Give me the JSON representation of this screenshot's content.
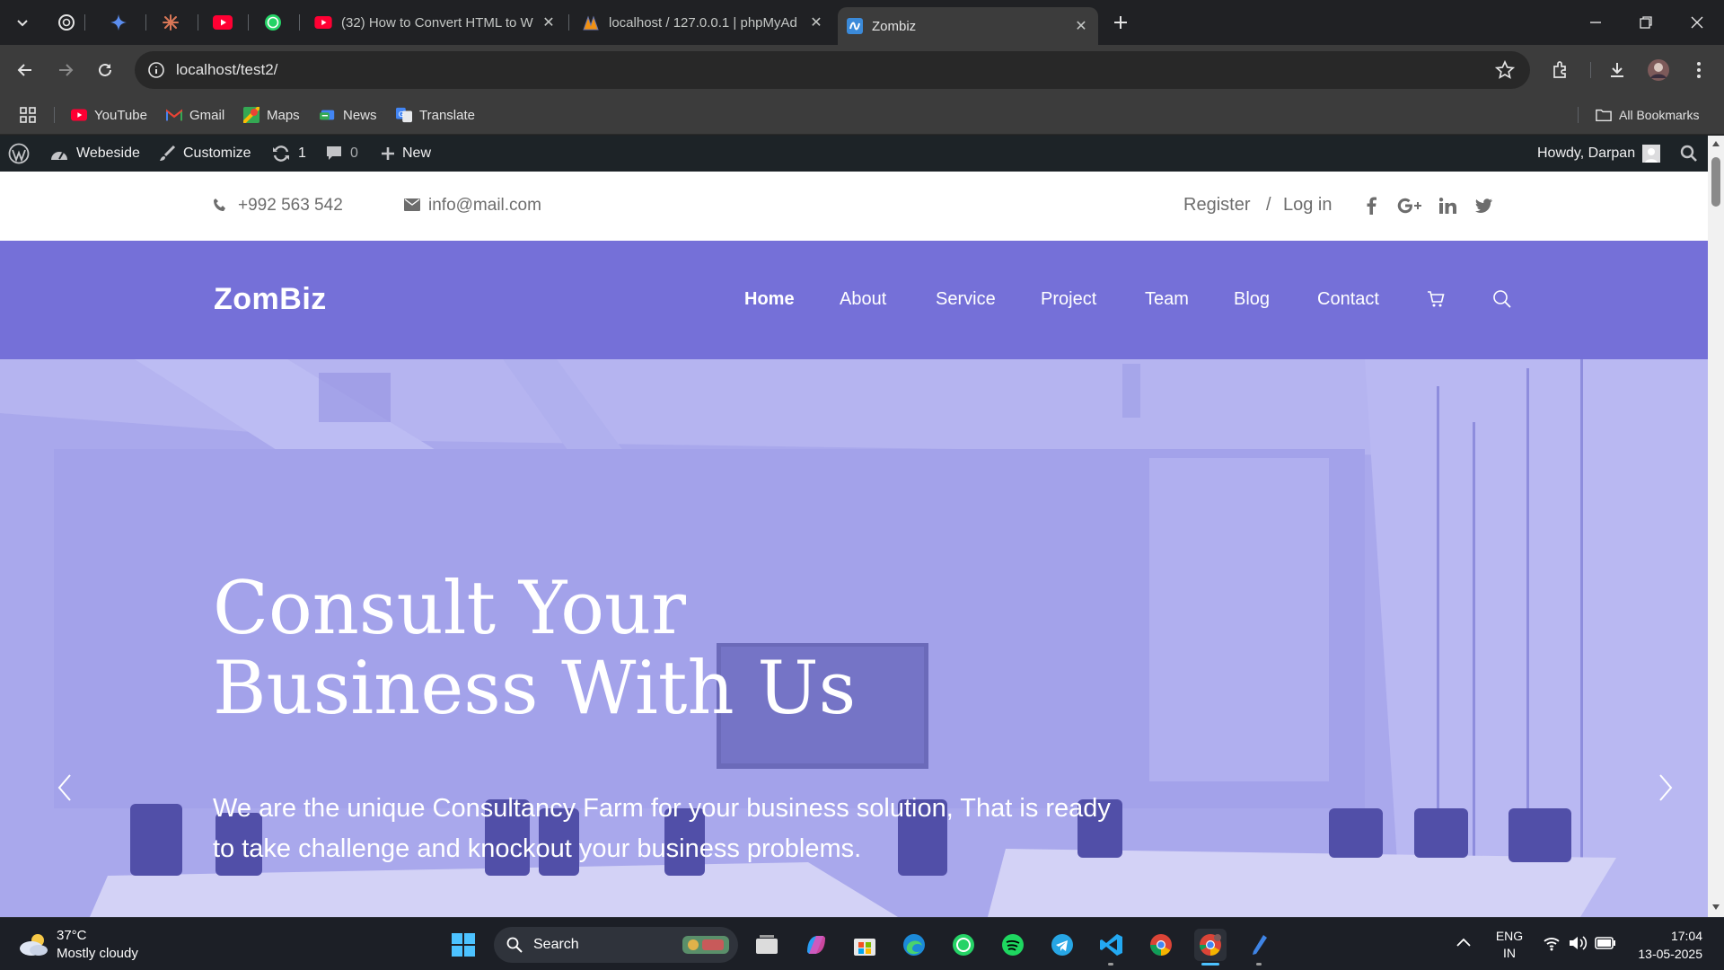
{
  "browser": {
    "tabs": [
      {
        "title": "(32) How to Convert HTML to W",
        "icon": "youtube-icon"
      },
      {
        "title": "localhost / 127.0.0.1 | phpMyAd",
        "icon": "phpmyadmin-icon"
      },
      {
        "title": "Zombiz",
        "icon": "site-favicon",
        "active": true
      }
    ],
    "url": "localhost/test2/",
    "bookmarks": [
      "YouTube",
      "Gmail",
      "Maps",
      "News",
      "Translate"
    ],
    "all_bookmarks": "All Bookmarks"
  },
  "adminbar": {
    "site_name": "Webeside",
    "customize": "Customize",
    "updates": "1",
    "comments": "0",
    "new": "New",
    "howdy": "Howdy, Darpan"
  },
  "topinfo": {
    "phone": "+992 563 542",
    "email": "info@mail.com",
    "register": "Register",
    "divider": "/",
    "login": "Log in"
  },
  "nav": {
    "logo": "ZomBiz",
    "items": [
      "Home",
      "About",
      "Service",
      "Project",
      "Team",
      "Blog",
      "Contact"
    ]
  },
  "hero": {
    "title_line1": "Consult Your",
    "title_line2": "Business With Us",
    "subtitle_line1": "We are the unique Consultancy Farm for your business solution, That is ready",
    "subtitle_line2": "to take challenge and knockout your business problems."
  },
  "taskbar": {
    "temperature": "37°C",
    "weather": "Mostly cloudy",
    "search": "Search",
    "lang1": "ENG",
    "lang2": "IN",
    "time": "17:04",
    "date": "13-05-2025"
  },
  "colors": {
    "nav_bg": "#7570d8",
    "hero_overlay": "#a7a6ec",
    "admin_bar": "#1d2327"
  }
}
